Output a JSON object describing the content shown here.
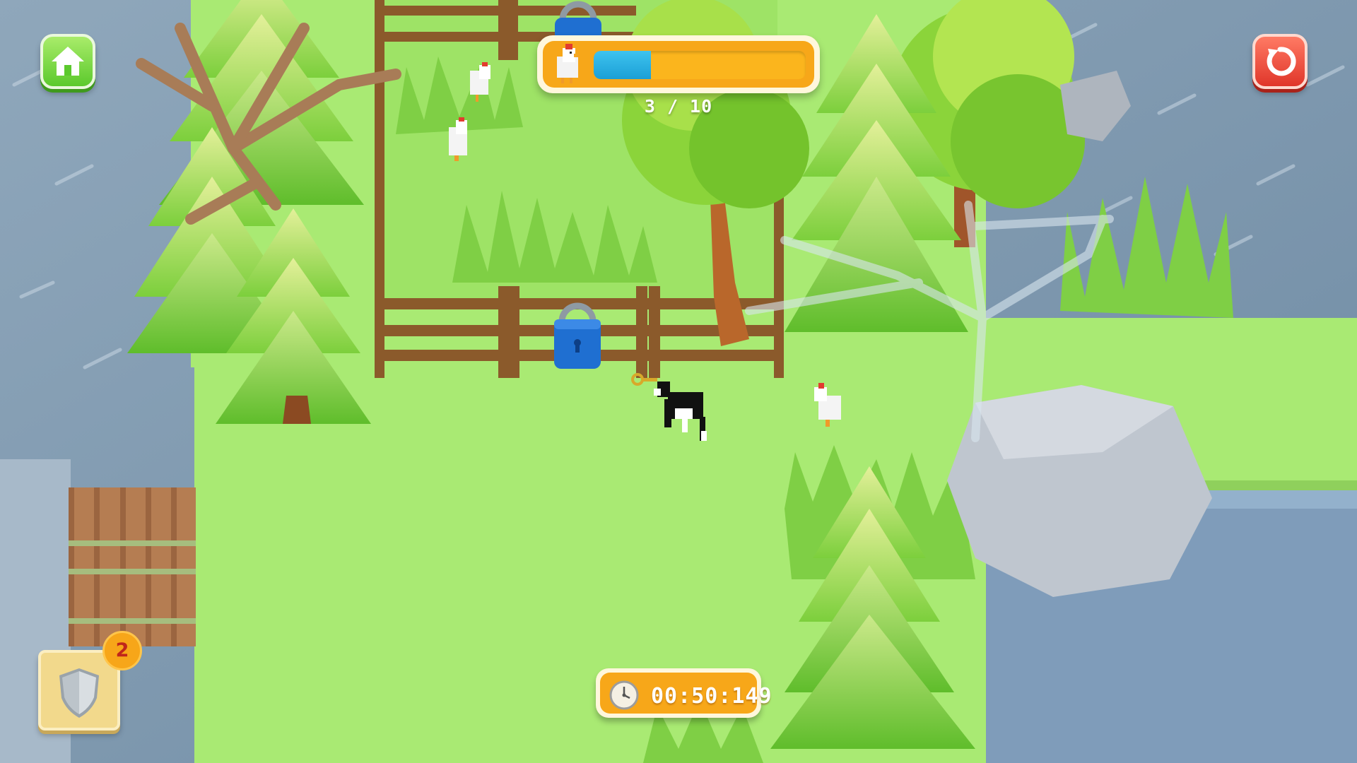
{
  "hud": {
    "home_icon": "home-icon",
    "restart_icon": "restart-icon",
    "progress": {
      "icon": "chicken-icon",
      "caught": 3,
      "total": 10,
      "count_text": "3 / 10",
      "fill_fraction": 0.27
    },
    "timer": {
      "icon": "stopwatch-icon",
      "time": "00:50:149"
    },
    "powerup": {
      "icon": "shield-icon",
      "count": "2"
    }
  },
  "scene": {
    "player": "black-and-white-dog-holding-key",
    "pen_locks": 2,
    "chickens": 4,
    "lock_color": "#1f6fd1"
  },
  "colors": {
    "grass": "#a9ea73",
    "water": "#7f9bb4",
    "fence": "#8b5a2b",
    "home_button": "#5cc92d",
    "restart_button": "#e0362a",
    "progress_fill": "#1b9fd6",
    "panel_orange": "#f7a719"
  }
}
